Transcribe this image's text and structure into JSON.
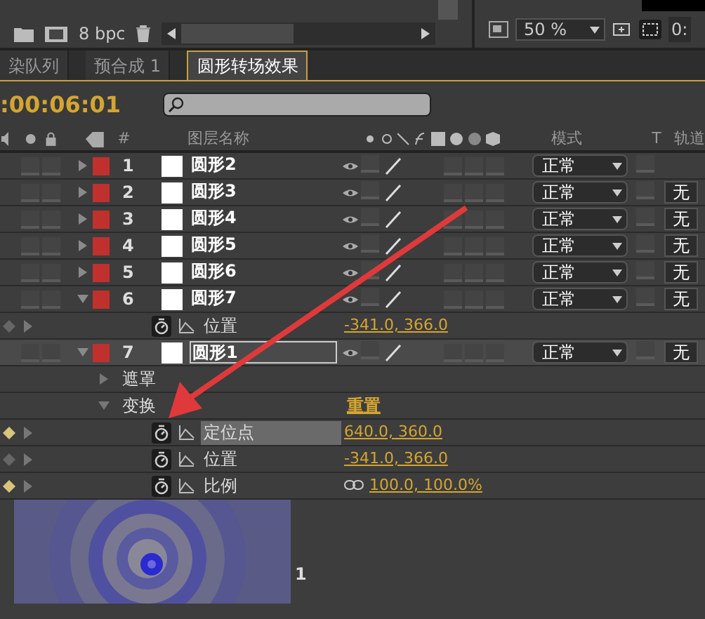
{
  "toolbar": {
    "bit_depth": "8 bpc",
    "zoom": "50 %",
    "time_partial": "0:"
  },
  "tabs": [
    {
      "label": "染队列",
      "selected": false
    },
    {
      "label": "预合成 1",
      "selected": false
    },
    {
      "label": "圆形转场效果",
      "selected": true
    }
  ],
  "timecode": ":00:06:01",
  "columns": {
    "number": "#",
    "layer_name": "图层名称",
    "mode": "模式",
    "t": "T",
    "track": "轨道"
  },
  "layers": [
    {
      "number": "1",
      "name": "圆形2",
      "expanded": false,
      "selected": false,
      "mode": "正常"
    },
    {
      "number": "2",
      "name": "圆形3",
      "expanded": false,
      "selected": false,
      "mode": "正常",
      "track": "无"
    },
    {
      "number": "3",
      "name": "圆形4",
      "expanded": false,
      "selected": false,
      "mode": "正常",
      "track": "无"
    },
    {
      "number": "4",
      "name": "圆形5",
      "expanded": false,
      "selected": false,
      "mode": "正常",
      "track": "无"
    },
    {
      "number": "5",
      "name": "圆形6",
      "expanded": false,
      "selected": false,
      "mode": "正常",
      "track": "无"
    },
    {
      "number": "6",
      "name": "圆形7",
      "expanded": true,
      "selected": false,
      "mode": "正常",
      "track": "无",
      "children": [
        {
          "kind": "property",
          "name": "位置",
          "value": "-341.0, 366.0",
          "keyframe": false,
          "selected": false
        }
      ]
    },
    {
      "number": "7",
      "name": "圆形1",
      "expanded": true,
      "selected": true,
      "mode": "正常",
      "track": "无",
      "children": [
        {
          "kind": "group",
          "name": "遮罩",
          "expanded": false
        },
        {
          "kind": "group",
          "name": "变换",
          "expanded": true,
          "value": "重置",
          "children": [
            {
              "kind": "property",
              "name": "定位点",
              "value": "640.0, 360.0",
              "keyframe": true,
              "selected": true
            },
            {
              "kind": "property",
              "name": "位置",
              "value": "-341.0, 366.0",
              "keyframe": false,
              "selected": false
            },
            {
              "kind": "property",
              "name": "比例",
              "value": "100.0, 100.0%",
              "keyframe": true,
              "selected": false,
              "linked": true
            }
          ]
        }
      ]
    }
  ],
  "footer_number": "1"
}
